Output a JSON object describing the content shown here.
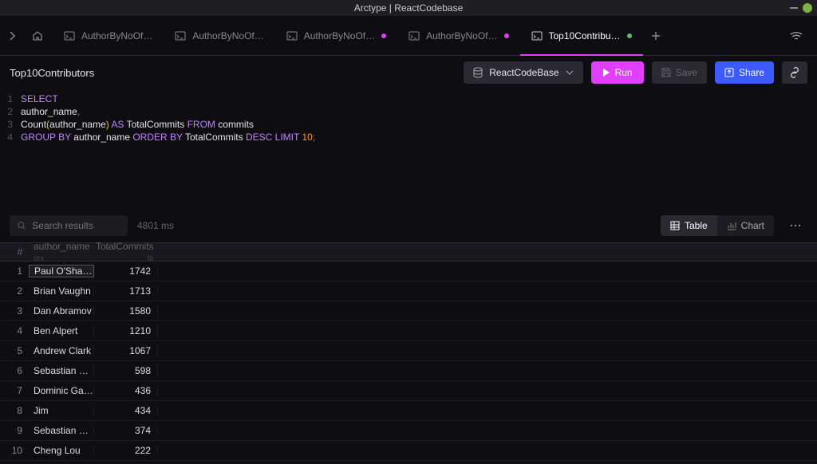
{
  "titlebar": {
    "text": "Arctype | ReactCodebase"
  },
  "tabs": [
    {
      "label": "AuthorByNoOf…",
      "modified": false
    },
    {
      "label": "AuthorByNoOf…",
      "modified": false
    },
    {
      "label": "AuthorByNoOf…",
      "modified": true,
      "dot_color": "mod"
    },
    {
      "label": "AuthorByNoOf…",
      "modified": true,
      "dot_color": "mod"
    },
    {
      "label": "Top10Contribu…",
      "modified": true,
      "dot_color": "unsaved",
      "active": true
    }
  ],
  "page_title": "Top10Contributors",
  "toolbar": {
    "db": "ReactCodeBase",
    "run": "Run",
    "save": "Save",
    "share": "Share"
  },
  "sql": {
    "l1_select": "SELECT",
    "l2": "author_name",
    "l3_count": "Count",
    "l3_col": "author_name",
    "l3_as": "AS",
    "l3_alias": "TotalCommits",
    "l3_from": "FROM",
    "l3_table": "commits",
    "l4_group": "GROUP",
    "l4_by1": "BY",
    "l4_col": "author_name",
    "l4_order": "ORDER",
    "l4_by2": "BY",
    "l4_alias": "TotalCommits",
    "l4_desc": "DESC",
    "l4_limit": "LIMIT",
    "l4_num": "10"
  },
  "results": {
    "search_placeholder": "Search results",
    "timing": "4801 ms",
    "view_table": "Table",
    "view_chart": "Chart",
    "columns": {
      "idx": "#",
      "c1": "author_name",
      "t1": "tex",
      "c2": "TotalCommits",
      "t2": "bi"
    },
    "rows": [
      {
        "n": "1",
        "author": "Paul O'Shann…",
        "commits": "1742"
      },
      {
        "n": "2",
        "author": "Brian Vaughn",
        "commits": "1713"
      },
      {
        "n": "3",
        "author": "Dan Abramov",
        "commits": "1580"
      },
      {
        "n": "4",
        "author": "Ben Alpert",
        "commits": "1210"
      },
      {
        "n": "5",
        "author": "Andrew Clark",
        "commits": "1067"
      },
      {
        "n": "6",
        "author": "Sebastian Ma…",
        "commits": "598"
      },
      {
        "n": "7",
        "author": "Dominic Gann…",
        "commits": "436"
      },
      {
        "n": "8",
        "author": "Jim",
        "commits": "434"
      },
      {
        "n": "9",
        "author": "Sebastian Ma…",
        "commits": "374"
      },
      {
        "n": "10",
        "author": "Cheng Lou",
        "commits": "222"
      }
    ]
  }
}
